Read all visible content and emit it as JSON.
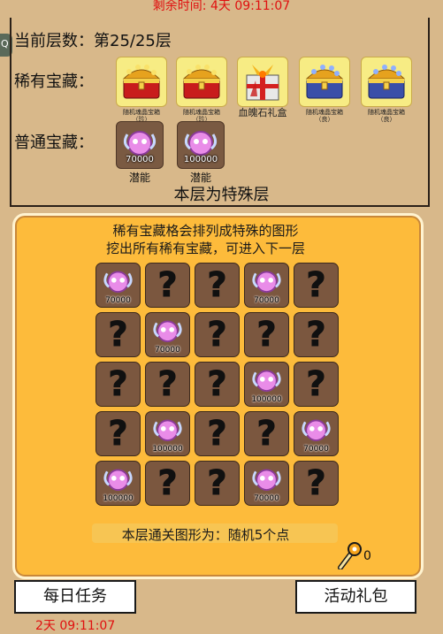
{
  "top_timer": "剩余时间: 4天 09:11:07",
  "side_tab_glyph": "Q",
  "layer_text": "当前层数：第25/25层",
  "rare_label": "稀有宝藏：",
  "common_label": "普通宝藏：",
  "rare_items": [
    {
      "caption": "随机魂晶宝箱（珍）",
      "icon": "gold-chest-icon"
    },
    {
      "caption": "随机魂晶宝箱（珍）",
      "icon": "gold-chest-icon"
    },
    {
      "caption": "血魄石礼盒",
      "icon": "gift-box-icon"
    },
    {
      "caption": "随机魂晶宝箱（良）",
      "icon": "blue-chest-icon"
    },
    {
      "caption": "随机魂晶宝箱（良）",
      "icon": "blue-chest-icon"
    }
  ],
  "common_items": [
    {
      "amount": "70000",
      "caption": "潜能",
      "icon": "potential-orb-icon"
    },
    {
      "amount": "100000",
      "caption": "潜能",
      "icon": "potential-orb-icon"
    }
  ],
  "special_layer_text": "本层为特殊层",
  "board": {
    "line1": "稀有宝藏格会排列成特殊的图形",
    "line2": "挖出所有稀有宝藏，可进入下一层",
    "description": "本层通关图形为：随机5个点",
    "key_count": "0",
    "hidden_symbol": "?",
    "rows": [
      [
        "70000",
        "?",
        "?",
        "70000",
        "?"
      ],
      [
        "?",
        "70000",
        "?",
        "?",
        "?"
      ],
      [
        "?",
        "?",
        "?",
        "100000",
        "?"
      ],
      [
        "?",
        "100000",
        "?",
        "?",
        "70000"
      ],
      [
        "100000",
        "?",
        "?",
        "70000",
        "?"
      ]
    ]
  },
  "buttons": {
    "daily": "每日任务",
    "event": "活动礼包"
  },
  "bottom_timer": "2天 09:11:07",
  "colors": {
    "timer": "#e01010",
    "board": "#fdbb3b",
    "cell": "#7b573f",
    "rare_bg": "#f7ec84"
  }
}
